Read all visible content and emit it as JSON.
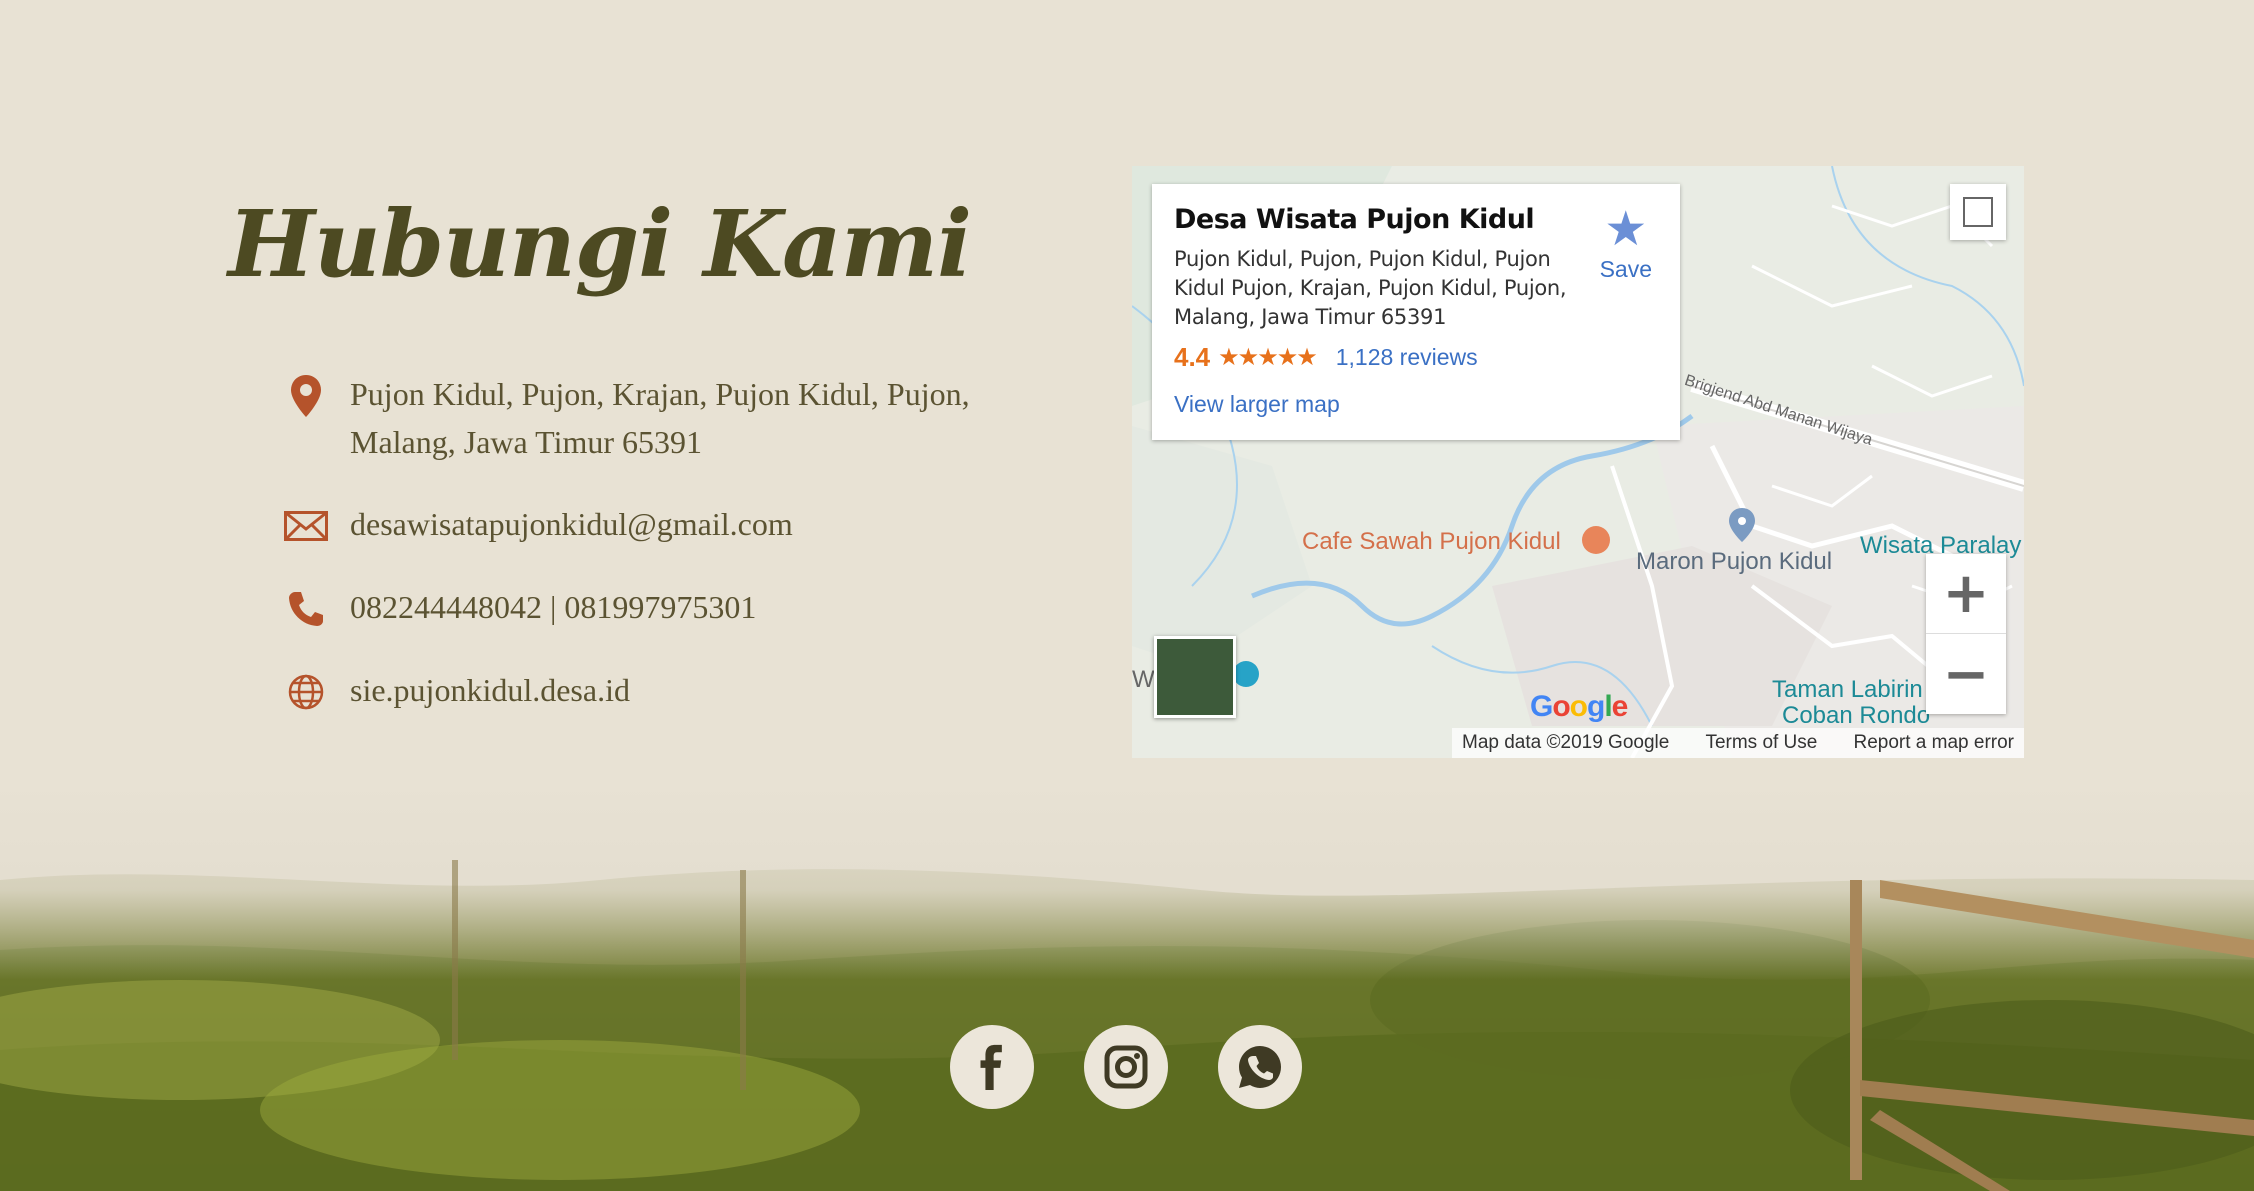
{
  "page": {
    "title": "Hubungi Kami"
  },
  "contact": {
    "address": "Pujon Kidul, Pujon, Krajan, Pujon Kidul, Pujon, Malang, Jawa Timur 65391",
    "email": "desawisatapujonkidul@gmail.com",
    "phone": "082244448042 | 081997975301",
    "website": "sie.pujonkidul.desa.id"
  },
  "map": {
    "place_name": "Desa Wisata Pujon Kidul",
    "place_address": "Pujon Kidul, Pujon, Pujon Kidul, Pujon Kidul Pujon, Krajan, Pujon Kidul, Pujon, Malang, Jawa Timur 65391",
    "rating": "4.4",
    "stars": "★★★★★",
    "reviews": "1,128 reviews",
    "larger_map": "View larger map",
    "save": "Save",
    "labels": {
      "cafe": "Cafe Sawah Pujon Kidul",
      "maron": "Maron Pujon Kidul",
      "wisata": "Wisata Paralay",
      "taman1": "Taman Labirin",
      "taman2": "Coban Rondo",
      "road": "Brigjend Abd Manan Wijaya",
      "wa": "Wa"
    },
    "google": "Google",
    "map_data": "Map data ©2019 Google",
    "terms": "Terms of Use",
    "report": "Report a map error",
    "zoom_in": "+",
    "zoom_out": "−"
  },
  "colors": {
    "background": "#e8e2d4",
    "title": "#4d4a22",
    "icon_accent": "#b5532b",
    "text": "#5b5332",
    "link": "#3a70c4",
    "rating": "#e7711b"
  },
  "icons": {
    "address": "map-pin-icon",
    "email": "envelope-icon",
    "phone": "phone-icon",
    "website": "globe-icon",
    "social": [
      "facebook-icon",
      "instagram-icon",
      "whatsapp-icon"
    ]
  }
}
